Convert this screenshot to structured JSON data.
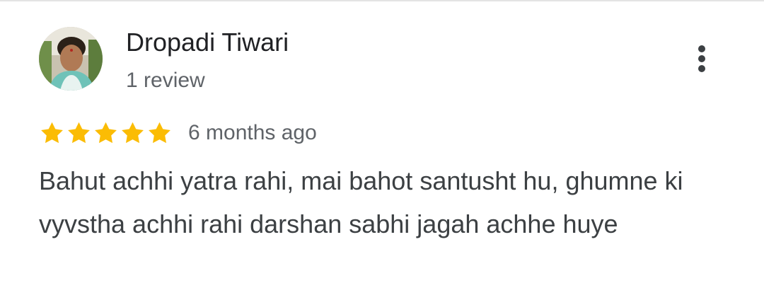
{
  "review": {
    "author_name": "Dropadi Tiwari",
    "review_count": "1 review",
    "rating": 5,
    "rating_max": 5,
    "date": "6 months ago",
    "text": "Bahut achhi yatra rahi, mai bahot santusht hu, ghumne ki vyvstha achhi rahi darshan sabhi jagah achhe huye",
    "more_icon": "more-vert-icon",
    "star_icon": "star-icon",
    "avatar": "profile-photo"
  },
  "colors": {
    "star": "#fbbc04",
    "name": "#202124",
    "secondary": "#5f6368",
    "body_text": "#3c4043"
  }
}
